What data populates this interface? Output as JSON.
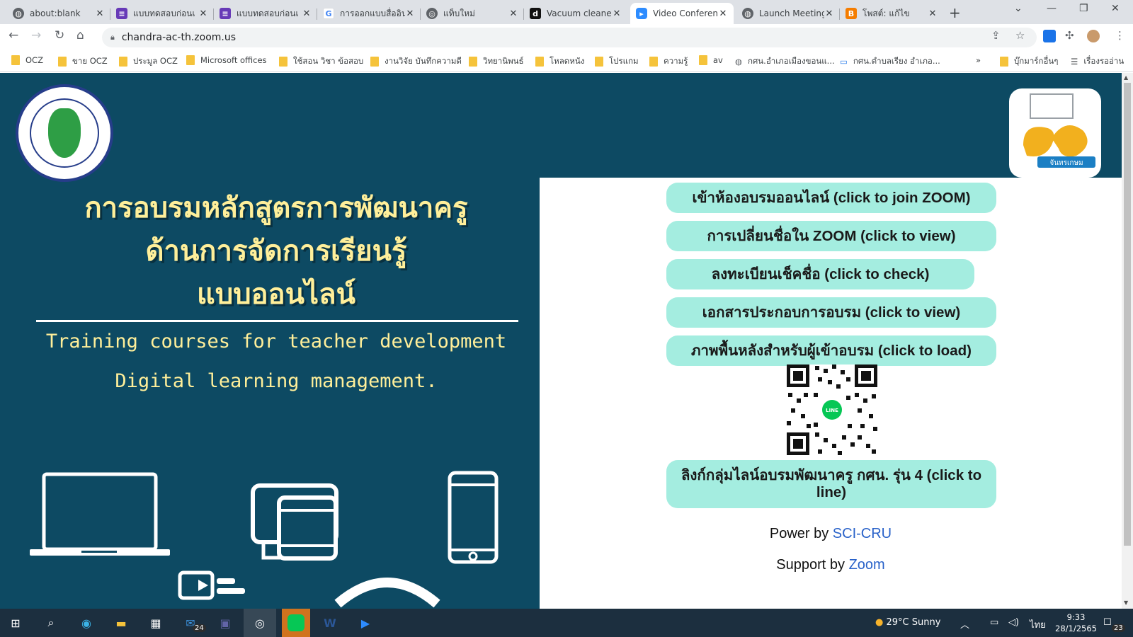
{
  "browser": {
    "tabs": [
      {
        "title": "about:blank",
        "icon": "globe-icon",
        "icon_color": "#5f6368"
      },
      {
        "title": "แบบทดสอบก่อนเ",
        "icon": "forms-icon",
        "icon_color": "#673ab7"
      },
      {
        "title": "แบบทดสอบก่อนเ",
        "icon": "forms-icon",
        "icon_color": "#673ab7"
      },
      {
        "title": "การออกแบบสื่ออินโ",
        "icon": "google-icon",
        "icon_color": "#4285f4"
      },
      {
        "title": "แท็บใหม่",
        "icon": "chrome-icon",
        "icon_color": "#5f6368"
      },
      {
        "title": "Vacuum cleaner",
        "icon": "d-icon",
        "icon_color": "#111111"
      },
      {
        "title": "Video Conferen",
        "icon": "zoom-icon",
        "icon_color": "#2d8cff"
      },
      {
        "title": "Launch Meeting",
        "icon": "globe-icon",
        "icon_color": "#5f6368"
      },
      {
        "title": "โพสต์: แก้ไข",
        "icon": "blogger-icon",
        "icon_color": "#f57d00"
      }
    ],
    "active_tab_index": 6,
    "url": "chandra-ac-th.zoom.us",
    "bookmarks": [
      {
        "label": "OCZ"
      },
      {
        "label": "ขาย OCZ"
      },
      {
        "label": "ประมูล OCZ"
      },
      {
        "label": "Microsoft offices"
      },
      {
        "label": "ใช้สอน วิชา ข้อสอบ"
      },
      {
        "label": "งานวิจัย บันทึกความดี"
      },
      {
        "label": "วิทยานิพนธ์"
      },
      {
        "label": "โหลดหนัง"
      },
      {
        "label": "โปรแกม"
      },
      {
        "label": "ความรู้"
      },
      {
        "label": "av"
      },
      {
        "label": "กศน.อำเภอเมืองขอนแ..."
      },
      {
        "label": "กศน.ตำบลเรียง อำเภอ..."
      }
    ],
    "bookmarks_more": "»",
    "other_bookmarks": "บุ๊กมาร์กอื่นๆ",
    "reading_list": "เรื่องรออ่าน"
  },
  "page": {
    "title_th": [
      "การอบรมหลักสูตรการพัฒนาครู",
      "ด้านการจัดการเรียนรู้",
      "แบบออนไลน์"
    ],
    "title_en": [
      "Training courses for teacher development",
      "Digital learning management."
    ],
    "logo_right_text": "จันทรเกษม",
    "links": [
      {
        "label": "เข้าห้องอบรมออนไลน์ (click to join ZOOM)"
      },
      {
        "label": "การเปลี่ยนชื่อใน ZOOM (click to view)"
      },
      {
        "label": "ลงทะเบียนเช็คชื่อ (click to check)"
      },
      {
        "label": "เอกสารประกอบการอบรม (click to view)"
      },
      {
        "label": "ภาพพื้นหลังสำหรับผู้เข้าอบรม (click to load)"
      }
    ],
    "qr_center_label": "LINE",
    "line_group_link": "ลิงก์กลุ่มไลน์อบรมพัฒนาครู กศน. รุ่น 4 (click to line)",
    "power_by_prefix": "Power by",
    "power_by_link": "SCI-CRU",
    "support_by_prefix": "Support by",
    "support_by_link": "Zoom",
    "colors": {
      "background": "#0d4a63",
      "title": "#ffef9a",
      "button": "#a4ede0",
      "link": "#2962c9"
    }
  },
  "taskbar": {
    "mail_badge": "24",
    "weather": "29°C  Sunny",
    "language": "ไทย",
    "time": "9:33",
    "date": "28/1/2565",
    "notification_count": "23"
  }
}
